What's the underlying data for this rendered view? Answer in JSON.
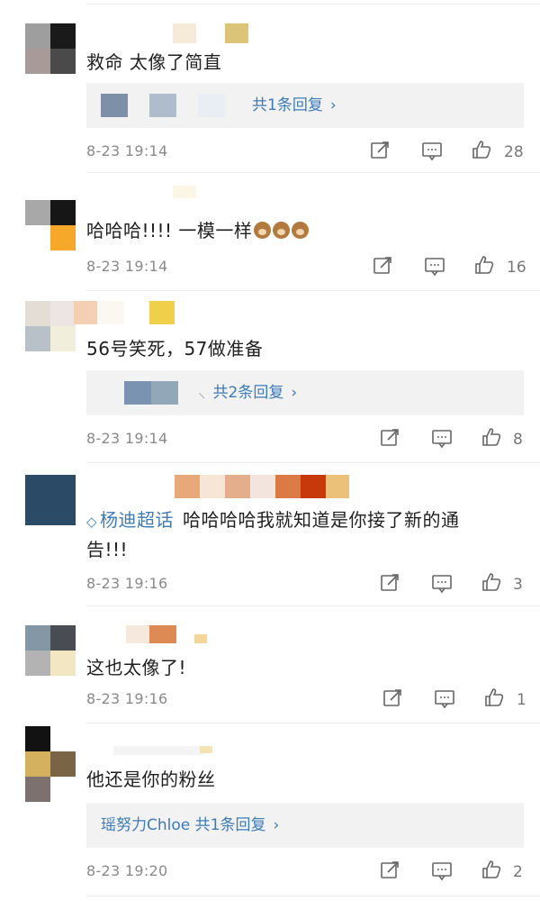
{
  "comments": [
    {
      "text": "救命 太像了简直",
      "reply_label": "共1条回复",
      "time": "8-23 19:14",
      "likes": "28"
    },
    {
      "text": "哈哈哈!!!! 一模一样",
      "time": "8-23 19:14",
      "likes": "16"
    },
    {
      "text": "56号笑死，57做准备",
      "reply_label": "共2条回复",
      "time": "8-23 19:14",
      "likes": "8"
    },
    {
      "topic": "杨迪超话",
      "text_line1": "哈哈哈哈我就知道是你接了新的通",
      "text_line2": "告!!!",
      "time": "8-23 19:16",
      "likes": "3"
    },
    {
      "text": "这也太像了!",
      "time": "8-23 19:16",
      "likes": "1"
    },
    {
      "text": "他还是你的粉丝",
      "reply_label": "瑶努力Chloe  共1条回复",
      "time": "8-23 19:20",
      "likes": "2"
    }
  ],
  "icons": {
    "share": "share-icon",
    "comment": "comment-icon",
    "like": "thumbs-up-icon",
    "topic": "topic-diamond-icon",
    "emoji": "monkey-emoji-icon"
  },
  "colors": {
    "link": "#3d7bb8",
    "meta": "#8a8a8a",
    "reply_bg": "#f2f2f2"
  }
}
